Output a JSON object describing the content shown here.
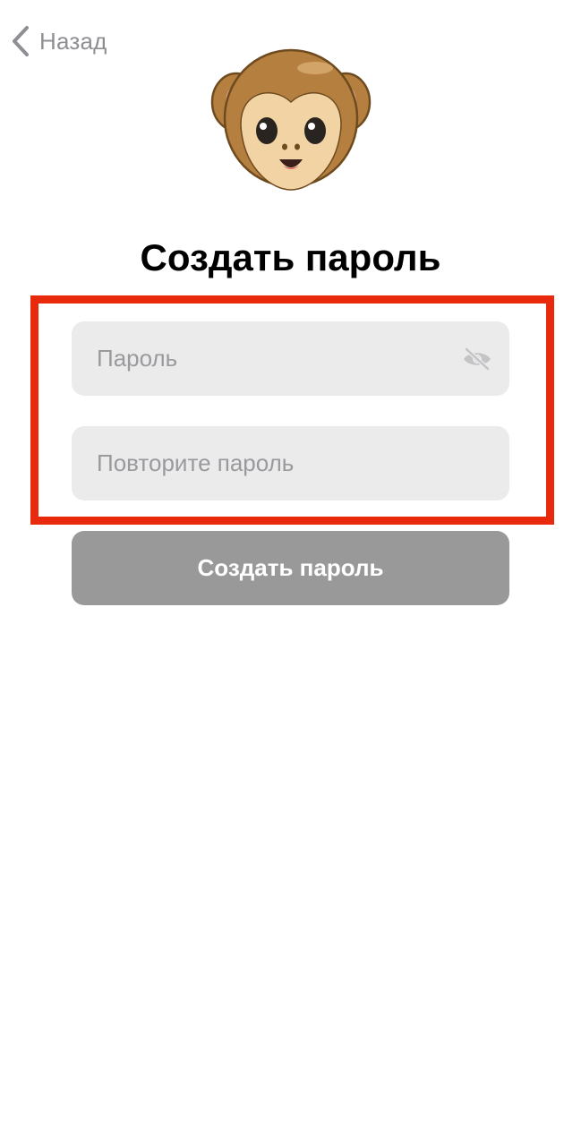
{
  "nav": {
    "back_label": "Назад",
    "back_icon": "chevron-left-icon"
  },
  "avatar": {
    "icon": "monkey-face-icon"
  },
  "title": "Создать пароль",
  "form": {
    "password_placeholder": "Пароль",
    "password_value": "",
    "visibility_icon": "eye-slash-icon",
    "repeat_placeholder": "Повторите пароль",
    "repeat_value": "",
    "submit_label": "Создать пароль"
  },
  "colors": {
    "highlight": "#e8290b",
    "field_background": "#ebebeb",
    "button_disabled": "#999999",
    "muted_text": "#8e8e93"
  }
}
